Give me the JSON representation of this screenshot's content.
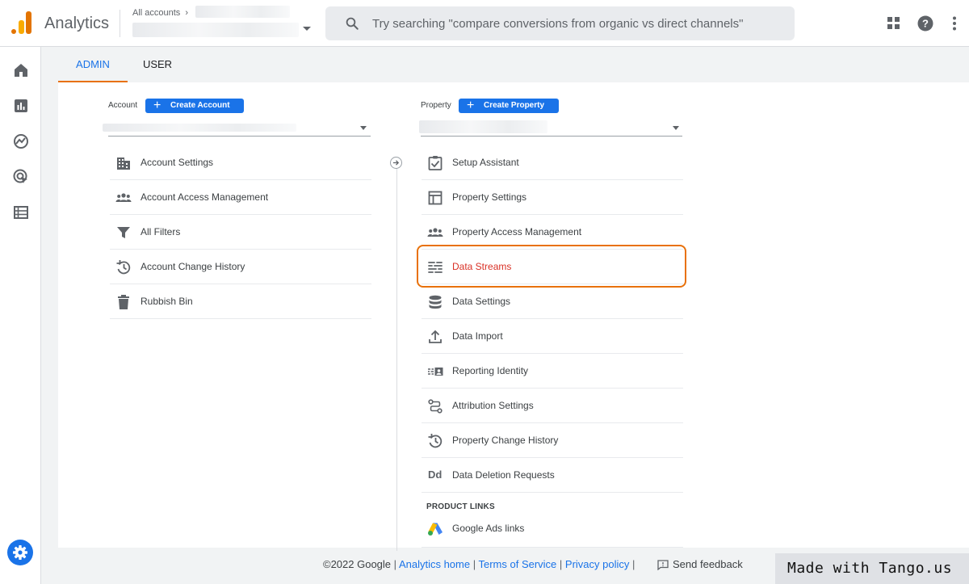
{
  "app": {
    "title": "Analytics"
  },
  "account_switcher": {
    "crumb": "All accounts"
  },
  "search": {
    "placeholder": "Try searching \"compare conversions from organic vs direct channels\""
  },
  "header_icons": [
    "apps-grid-icon",
    "help-icon",
    "more-vert-icon"
  ],
  "rail": {
    "items": [
      "home-icon",
      "reports-icon",
      "explore-icon",
      "advertising-icon",
      "configure-icon"
    ],
    "settings": "settings-gear-icon"
  },
  "tabs": [
    {
      "label": "ADMIN",
      "active": true
    },
    {
      "label": "USER",
      "active": false
    }
  ],
  "account_column": {
    "label": "Account",
    "create_button": "Create Account",
    "items": [
      {
        "label": "Account Settings",
        "icon": "building-icon"
      },
      {
        "label": "Account Access Management",
        "icon": "people-icon"
      },
      {
        "label": "All Filters",
        "icon": "filter-icon"
      },
      {
        "label": "Account Change History",
        "icon": "history-icon"
      },
      {
        "label": "Rubbish Bin",
        "icon": "trash-icon"
      }
    ]
  },
  "property_column": {
    "label": "Property",
    "create_button": "Create Property",
    "items": [
      {
        "label": "Setup Assistant",
        "icon": "checklist-icon"
      },
      {
        "label": "Property Settings",
        "icon": "window-layout-icon"
      },
      {
        "label": "Property Access Management",
        "icon": "people-icon"
      },
      {
        "label": "Data Streams",
        "icon": "data-streams-icon",
        "selected": true
      },
      {
        "label": "Data Settings",
        "icon": "database-icon"
      },
      {
        "label": "Data Import",
        "icon": "upload-icon"
      },
      {
        "label": "Reporting Identity",
        "icon": "reporting-identity-icon"
      },
      {
        "label": "Attribution Settings",
        "icon": "attribution-icon"
      },
      {
        "label": "Property Change History",
        "icon": "history-icon"
      },
      {
        "label": "Data Deletion Requests",
        "icon": "dd-icon"
      }
    ],
    "product_links_label": "PRODUCT LINKS",
    "product_links": [
      {
        "label": "Google Ads links",
        "icon": "google-ads-icon"
      }
    ]
  },
  "colors": {
    "accent": "#1a73e8",
    "highlight": "#e8710a",
    "selected_text": "#d93025"
  },
  "footer": {
    "copyright": "©2022 Google",
    "links": [
      "Analytics home",
      "Terms of Service",
      "Privacy policy"
    ],
    "feedback": "Send feedback"
  },
  "watermark": "Made with Tango.us"
}
